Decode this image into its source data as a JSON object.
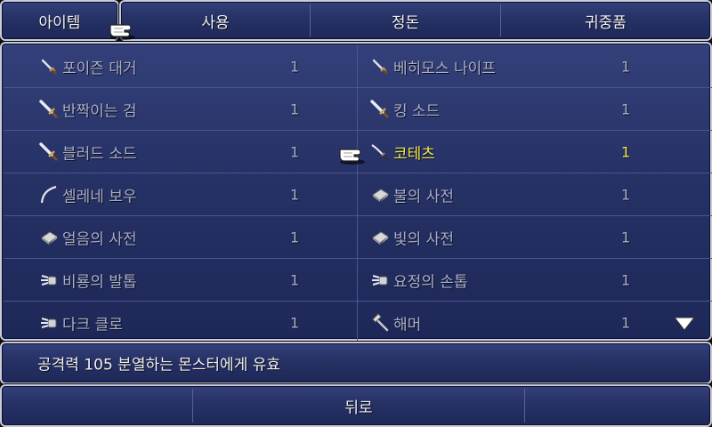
{
  "menu": {
    "category": "아이템",
    "use": "사용",
    "sort": "정돈",
    "key_items": "귀중품"
  },
  "items": [
    {
      "name": "포이즌 대거",
      "qty": "1",
      "icon": "dagger-icon",
      "selected": false
    },
    {
      "name": "베히모스 나이프",
      "qty": "1",
      "icon": "dagger-icon",
      "selected": false
    },
    {
      "name": "반짝이는 검",
      "qty": "1",
      "icon": "sword-icon",
      "selected": false
    },
    {
      "name": "킹 소드",
      "qty": "1",
      "icon": "sword-icon",
      "selected": false
    },
    {
      "name": "블러드 소드",
      "qty": "1",
      "icon": "sword-icon",
      "selected": false
    },
    {
      "name": "코테츠",
      "qty": "1",
      "icon": "katana-icon",
      "selected": true
    },
    {
      "name": "셀레네 보우",
      "qty": "1",
      "icon": "bow-icon",
      "selected": false
    },
    {
      "name": "불의 사전",
      "qty": "1",
      "icon": "book-icon",
      "selected": false
    },
    {
      "name": "얼음의 사전",
      "qty": "1",
      "icon": "book-icon",
      "selected": false
    },
    {
      "name": "빛의 사전",
      "qty": "1",
      "icon": "book-icon",
      "selected": false
    },
    {
      "name": "비룡의 발톱",
      "qty": "1",
      "icon": "claw-icon",
      "selected": false
    },
    {
      "name": "요정의 손톱",
      "qty": "1",
      "icon": "claw-icon",
      "selected": false
    },
    {
      "name": "다크 클로",
      "qty": "1",
      "icon": "claw-icon",
      "selected": false
    },
    {
      "name": "해머",
      "qty": "1",
      "icon": "hammer-icon",
      "selected": false
    }
  ],
  "description": "공격력 105 분열하는 몬스터에게 유효",
  "back_label": "뒤로",
  "colors": {
    "panel": "#263165",
    "border": "#c9ccd8",
    "selected_text": "#f2e84a",
    "dim_text": "#aab0c8"
  }
}
